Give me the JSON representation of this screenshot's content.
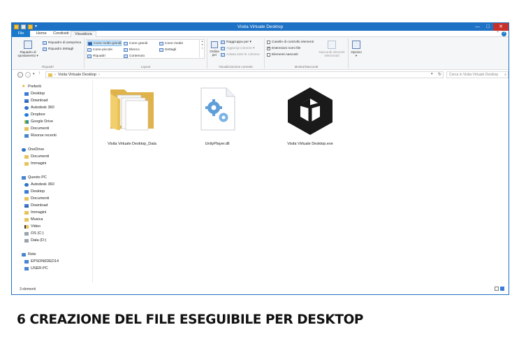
{
  "window": {
    "title": "Visita Virtuale Desktop",
    "controls": {
      "minimize": "—",
      "maximize": "□",
      "close": "✕"
    }
  },
  "ribbon": {
    "tabs": [
      "File",
      "Home",
      "Condividi",
      "Visualizza"
    ],
    "active_tab": "Visualizza",
    "groups": {
      "riquadri": {
        "label": "Riquadri",
        "navigation_pane": "Riquadro di spostamento",
        "preview_pane": "Riquadro di anteprima",
        "details_pane": "Riquadro dettagli"
      },
      "layout": {
        "label": "Layout",
        "options": [
          "Icone molto grandi",
          "Icone grandi",
          "Icone medie",
          "Icone piccole",
          "Elenco",
          "Dettagli",
          "Riquadri",
          "Contenuto"
        ],
        "selected": "Icone molto grandi"
      },
      "current_view": {
        "label": "Visualizzazione corrente",
        "sort_by": "Ordina per",
        "group_by": "Raggruppa per",
        "add_columns": "Aggiungi colonne",
        "fit_columns": "Adatta tutte le colonne"
      },
      "show_hide": {
        "label": "Mostra/Nascondi",
        "item_checkboxes": {
          "label": "Caselle di controllo elementi",
          "checked": false
        },
        "file_extensions": {
          "label": "Estensioni nomi file",
          "checked": true
        },
        "hidden_items": {
          "label": "Elementi nascosti",
          "checked": false
        },
        "hide_selected": "Nascondi elementi selezionati"
      },
      "options": {
        "label": "Opzioni"
      }
    }
  },
  "address": {
    "path": [
      "Visita Virtuale Desktop"
    ],
    "search_placeholder": "Cerca in Visita Virtuale Desktop"
  },
  "nav": {
    "favorites_label": "Preferiti",
    "favorites": [
      "Desktop",
      "Download",
      "Autodesk 360",
      "Dropbox",
      "Google Drive",
      "Documenti",
      "Risorse recenti"
    ],
    "onedrive_label": "OneDrive",
    "onedrive": [
      "Documenti",
      "Immagini"
    ],
    "pc_label": "Questo PC",
    "pc": [
      "Autodesk 360",
      "Desktop",
      "Documenti",
      "Download",
      "Immagini",
      "Musica",
      "Video",
      "OS (C:)",
      "Data (D:)"
    ],
    "network_label": "Rete",
    "network": [
      "EPSON6DED14",
      "USER-PC"
    ]
  },
  "files": [
    {
      "name": "Visita Virtuale Desktop_Data",
      "icon": "folder-icon"
    },
    {
      "name": "UnityPlayer.dll",
      "icon": "dll-gear-icon"
    },
    {
      "name": "Visita Virtuale Desktop.exe",
      "icon": "unity-logo-icon"
    }
  ],
  "status": {
    "count_text": "3 elementi"
  },
  "caption": "6 CREAZIONE DEL FILE ESEGUIBILE PER DESKTOP"
}
